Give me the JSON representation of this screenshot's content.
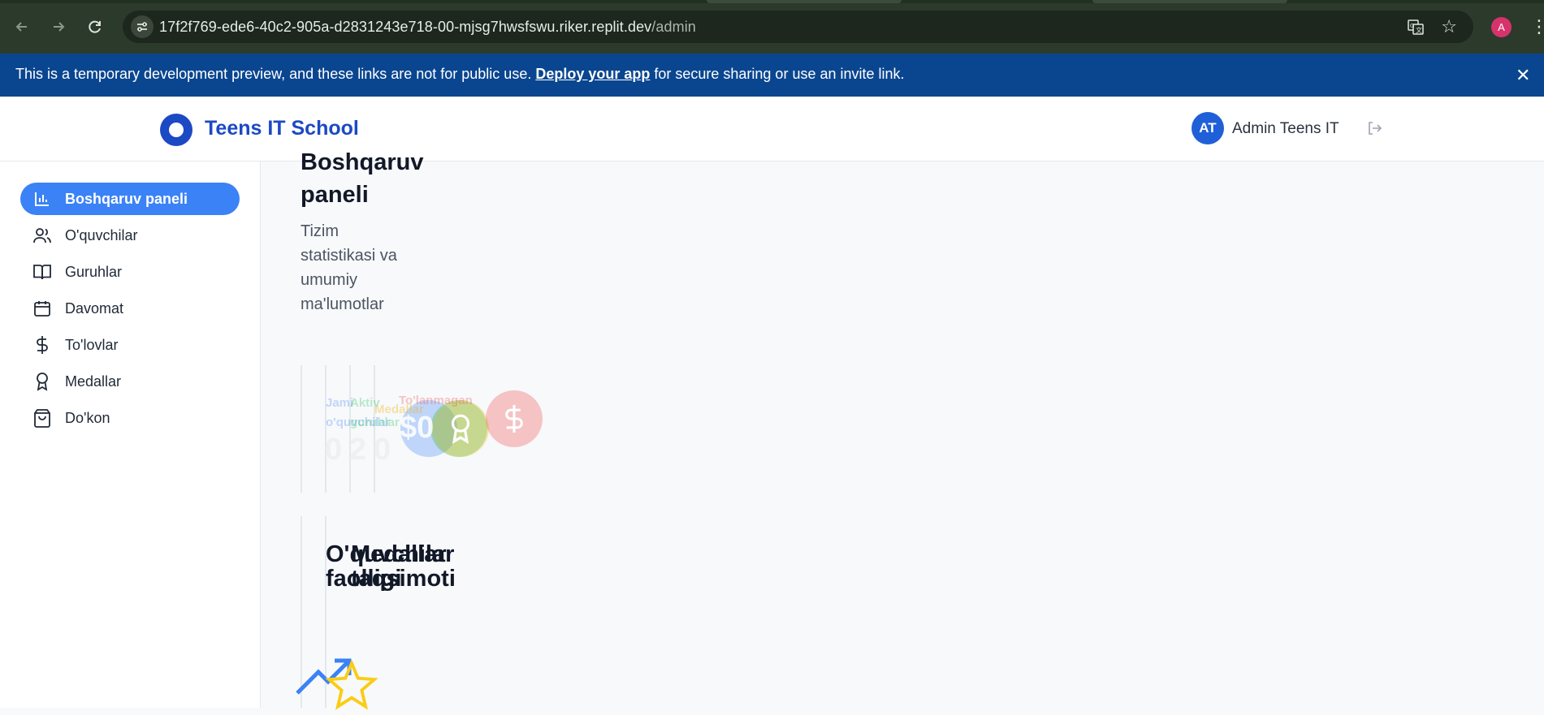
{
  "browser": {
    "url_host": "17f2f769-ede6-40c2-905a-d2831243e718-00-mjsg7hwsfswu.riker.replit.dev",
    "url_path": "/admin",
    "profile_initial": "A"
  },
  "banner": {
    "text_before": "This is a temporary development preview, and these links are not for public use. ",
    "link": "Deploy your app",
    "text_after": " for secure sharing or use an invite link."
  },
  "header": {
    "brand": "Teens IT School",
    "avatar_initials": "AT",
    "user_name": "Admin Teens IT"
  },
  "sidebar": {
    "items": [
      {
        "label": "Boshqaruv paneli",
        "icon": "bar-chart-icon",
        "active": true
      },
      {
        "label": "O'quvchilar",
        "icon": "users-icon",
        "active": false
      },
      {
        "label": "Guruhlar",
        "icon": "book-open-icon",
        "active": false
      },
      {
        "label": "Davomat",
        "icon": "calendar-icon",
        "active": false
      },
      {
        "label": "To'lovlar",
        "icon": "dollar-icon",
        "active": false
      },
      {
        "label": "Medallar",
        "icon": "award-icon",
        "active": false
      },
      {
        "label": "Do'kon",
        "icon": "shopping-bag-icon",
        "active": false
      }
    ]
  },
  "main": {
    "title": "Boshqaruv paneli",
    "subtitle": "Tizim statistikasi va umumiy ma'lumotlar",
    "stats": [
      {
        "label": "Jami o'quvchilar",
        "value": "0",
        "color": "#3b82f6"
      },
      {
        "label": "Aktiv guruhlar",
        "value": "2",
        "color": "#22c55e"
      },
      {
        "label": "Medallar",
        "value": "0",
        "color": "#eab308"
      },
      {
        "label": "To'lanmagan",
        "value": "$0",
        "color": "#ef4444"
      }
    ],
    "sections": [
      {
        "title": "O'quvchilar faolligi"
      },
      {
        "title": "Medallar taqsimoti"
      }
    ]
  },
  "colors": {
    "chrome_bg": "#2c3a2c",
    "banner_bg": "#0a4690",
    "brand": "#1c49c4",
    "active_nav": "#3b82f6"
  }
}
